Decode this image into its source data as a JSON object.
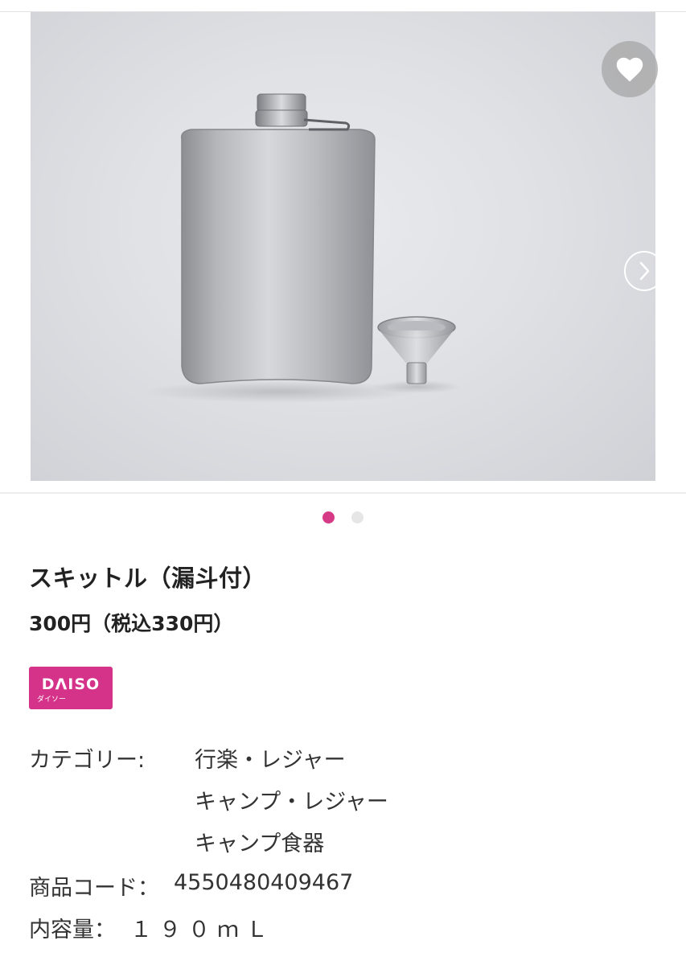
{
  "gallery": {
    "active_index": 0,
    "dot_count": 2,
    "colors": {
      "active_dot": "#d63a86",
      "inactive_dot": "#e6e6e6"
    }
  },
  "product": {
    "title": "スキットル（漏斗付）",
    "price": "300円（税込330円）"
  },
  "brand": {
    "name": "DΛISO",
    "subtext": "ダイソー",
    "color": "#d5338a"
  },
  "specs": {
    "category_label": "カテゴリー:",
    "categories": [
      "行楽・レジャー",
      "キャンプ・レジャー",
      "キャンプ食器"
    ],
    "code_label": "商品コード：",
    "code_value": "4550480409467",
    "capacity_label": "内容量：",
    "capacity_value": "１９０ｍＬ"
  },
  "icons": {
    "favorite": "heart-icon",
    "next": "chevron-right-icon"
  }
}
